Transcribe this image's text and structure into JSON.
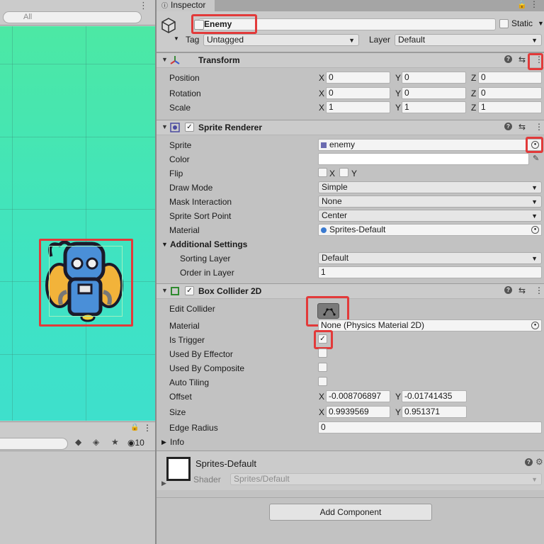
{
  "scene": {
    "search_placeholder": "All",
    "menu_glyph": "⋮"
  },
  "project": {
    "lock_glyph": "🔒",
    "menu_glyph": "⋮",
    "hidden_count": "10"
  },
  "inspector": {
    "tab_label": "Inspector",
    "lock_glyph": "🔒",
    "menu_glyph": "⋮"
  },
  "gameobject": {
    "active_mark": "",
    "name": "Enemy",
    "static_label": "Static",
    "tag_label": "Tag",
    "tag_value": "Untagged",
    "layer_label": "Layer",
    "layer_value": "Default"
  },
  "transform": {
    "title": "Transform",
    "position": {
      "label": "Position",
      "x": "0",
      "y": "0",
      "z": "0"
    },
    "rotation": {
      "label": "Rotation",
      "x": "0",
      "y": "0",
      "z": "0"
    },
    "scale": {
      "label": "Scale",
      "x": "1",
      "y": "1",
      "z": "1"
    }
  },
  "axes": {
    "x": "X",
    "y": "Y",
    "z": "Z"
  },
  "sprite_renderer": {
    "title": "Sprite Renderer",
    "enabled_mark": "✓",
    "sprite_label": "Sprite",
    "sprite_value": "enemy",
    "color_label": "Color",
    "flip_label": "Flip",
    "flip_x": "X",
    "flip_y": "Y",
    "draw_mode_label": "Draw Mode",
    "draw_mode_value": "Simple",
    "mask_label": "Mask Interaction",
    "mask_value": "None",
    "sort_point_label": "Sprite Sort Point",
    "sort_point_value": "Center",
    "material_label": "Material",
    "material_value": "Sprites-Default",
    "additional_label": "Additional Settings",
    "sorting_layer_label": "Sorting Layer",
    "sorting_layer_value": "Default",
    "order_label": "Order in Layer",
    "order_value": "1"
  },
  "box_collider": {
    "title": "Box Collider 2D",
    "enabled_mark": "✓",
    "edit_label": "Edit Collider",
    "material_label": "Material",
    "material_value": "None (Physics Material 2D)",
    "trigger_label": "Is Trigger",
    "trigger_mark": "✓",
    "effector_label": "Used By Effector",
    "composite_label": "Used By Composite",
    "tiling_label": "Auto Tiling",
    "offset_label": "Offset",
    "offset_x": "-0.008706897",
    "offset_y": "-0.01741435",
    "size_label": "Size",
    "size_x": "0.9939569",
    "size_y": "0.951371",
    "radius_label": "Edge Radius",
    "radius_value": "0",
    "info_label": "Info"
  },
  "material": {
    "name": "Sprites-Default",
    "shader_label": "Shader",
    "shader_value": "Sprites/Default"
  },
  "add_component_label": "Add Component",
  "colors": {
    "highlight": "#e23a3a",
    "scene_top": "#4ce8a4",
    "scene_bottom": "#3ee0cc"
  }
}
